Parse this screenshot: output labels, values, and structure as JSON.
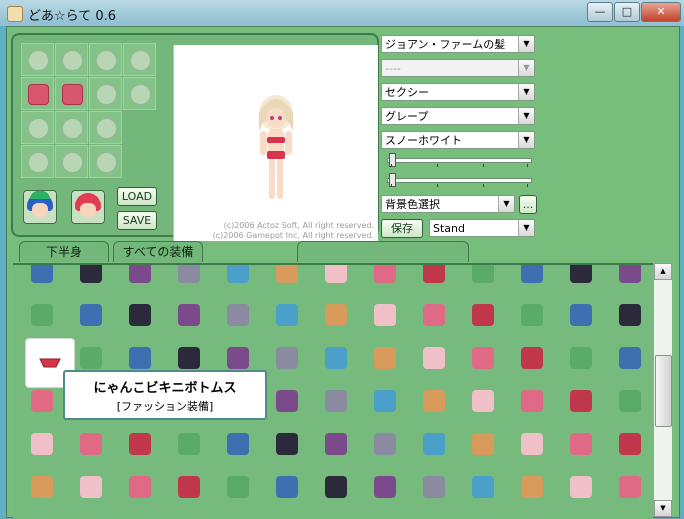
{
  "window": {
    "title": "どあ☆らて 0.6"
  },
  "window_buttons": {
    "minimize": "—",
    "maximize": "□",
    "close": "✕"
  },
  "buttons": {
    "load": "LOAD",
    "save": "SAVE",
    "store": "保存",
    "more": "..."
  },
  "preview": {
    "copyright_1": "(c)2006 Actoz Soft, All right reserved.",
    "copyright_2": "(c)2006 Gamepot Inc, All right reserved."
  },
  "selects": {
    "hair": "ジョアン・ファームの髪",
    "hair_sub": "----",
    "style": "セクシー",
    "color1": "グレープ",
    "color2": "スノーホワイト",
    "bg_color": "背景色選択",
    "pose": "Stand"
  },
  "sliders": [
    {
      "label": "",
      "value": 0.0
    },
    {
      "label": "",
      "value": 0.0
    }
  ],
  "tabs": [
    {
      "label": "下半身"
    },
    {
      "label": "すべての装備"
    },
    {
      "label": ""
    }
  ],
  "tooltip": {
    "title": "にゃんこビキニボトムス",
    "subtitle": "[ファッション装備]"
  },
  "colors": {
    "panel": "#73b87a",
    "border": "#3f7a4c",
    "accent_red": "#d8566e"
  }
}
